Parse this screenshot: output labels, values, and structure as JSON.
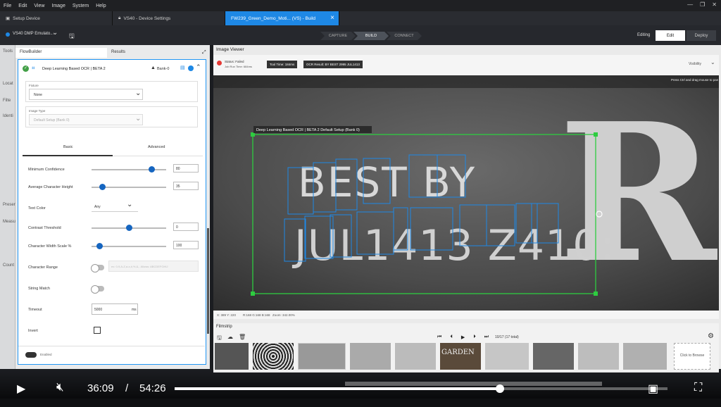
{
  "menu": [
    "File",
    "Edit",
    "View",
    "Image",
    "System",
    "Help"
  ],
  "tabs": [
    {
      "label": "Setup Device",
      "active": false
    },
    {
      "label": "VS40 - Device Settings",
      "active": false
    },
    {
      "label": "FW239_Green_Demo_Moti... (VS) - Build",
      "active": true
    }
  ],
  "toolbar": {
    "device": "VS40 DMP Emulato...",
    "steps": [
      "CAPTURE",
      "BUILD",
      "CONNECT"
    ],
    "editing_label": "Editing",
    "edit_btn": "Edit",
    "deploy_btn": "Deploy"
  },
  "left_strip": [
    "Tools",
    "Locat",
    "Filte",
    "Identi",
    "Presence",
    "Measu",
    "Count"
  ],
  "panel_tabs": {
    "flowbuilder": "FlowBuilder",
    "results": "Results"
  },
  "tool": {
    "title": "Deep Learning Based OCR | BETA 2",
    "bank": "Bank-0"
  },
  "fields": {
    "fixture_label": "Fixture",
    "fixture_value": "None",
    "image_type_label": "Image Type",
    "image_type_value": "Default Setup (Bank 0)"
  },
  "subtabs": {
    "basic": "Basic",
    "advanced": "Advanced"
  },
  "params": {
    "min_conf_label": "Minimum Confidence",
    "min_conf_value": "80",
    "avg_height_label": "Average Character Height",
    "avg_height_value": "35",
    "text_color_label": "Text Color",
    "text_color_value": "Any",
    "contrast_label": "Contrast Threshold",
    "contrast_value": "0",
    "width_scale_label": "Character Width Scale %",
    "width_scale_value": "100",
    "char_range_label": "Character Range",
    "char_range_placeholder": "ex: 0-9,A-Z,a-z,#,%,&,-  Allows: ABCDEFGHIJ",
    "string_match_label": "String Match",
    "timeout_label": "Timeout",
    "timeout_value": "5000",
    "timeout_unit": "ms",
    "invert_label": "Invert",
    "enabled_label": "Enabled"
  },
  "slider_levels": {
    "min_conf": 0.8,
    "avg_height": 0.14,
    "contrast": 0.5,
    "width_scale": 0.1
  },
  "viewer": {
    "title": "Image Viewer",
    "status": "Status: Failed",
    "job_run_time": "Job Run Time: 684ms",
    "tool_time": "Tool Time: 184ms",
    "ocr_result": "OCR Result: BY BEST 2995 JUL1413",
    "visibility": "Visibility",
    "hint": "Press Ctrl and drag mouse to pan",
    "roi_label": "Deep Learning Based OCR | BETA 2   Default Setup (Bank 0)",
    "coords": "X: 389 Y: 220",
    "rgb": "R:168 G:168 B:168",
    "zoom": "Zoom: 342.00%"
  },
  "image_text": {
    "line1": "BEST BY",
    "line2": "JUL1413 Z410:",
    "big": "R"
  },
  "filmstrip": {
    "title": "Filmstrip",
    "counter": "10/17 (17 total)",
    "thumb_label": "GARDEN",
    "browse": "Click to Browse"
  },
  "video": {
    "current": "36:09",
    "sep": "/",
    "total": "54:26",
    "progress": 0.66
  },
  "colors": {
    "accent": "#1e88e5",
    "roi": "#2ecc40",
    "char_box": "#1e88e5",
    "status_red": "#e53935"
  }
}
